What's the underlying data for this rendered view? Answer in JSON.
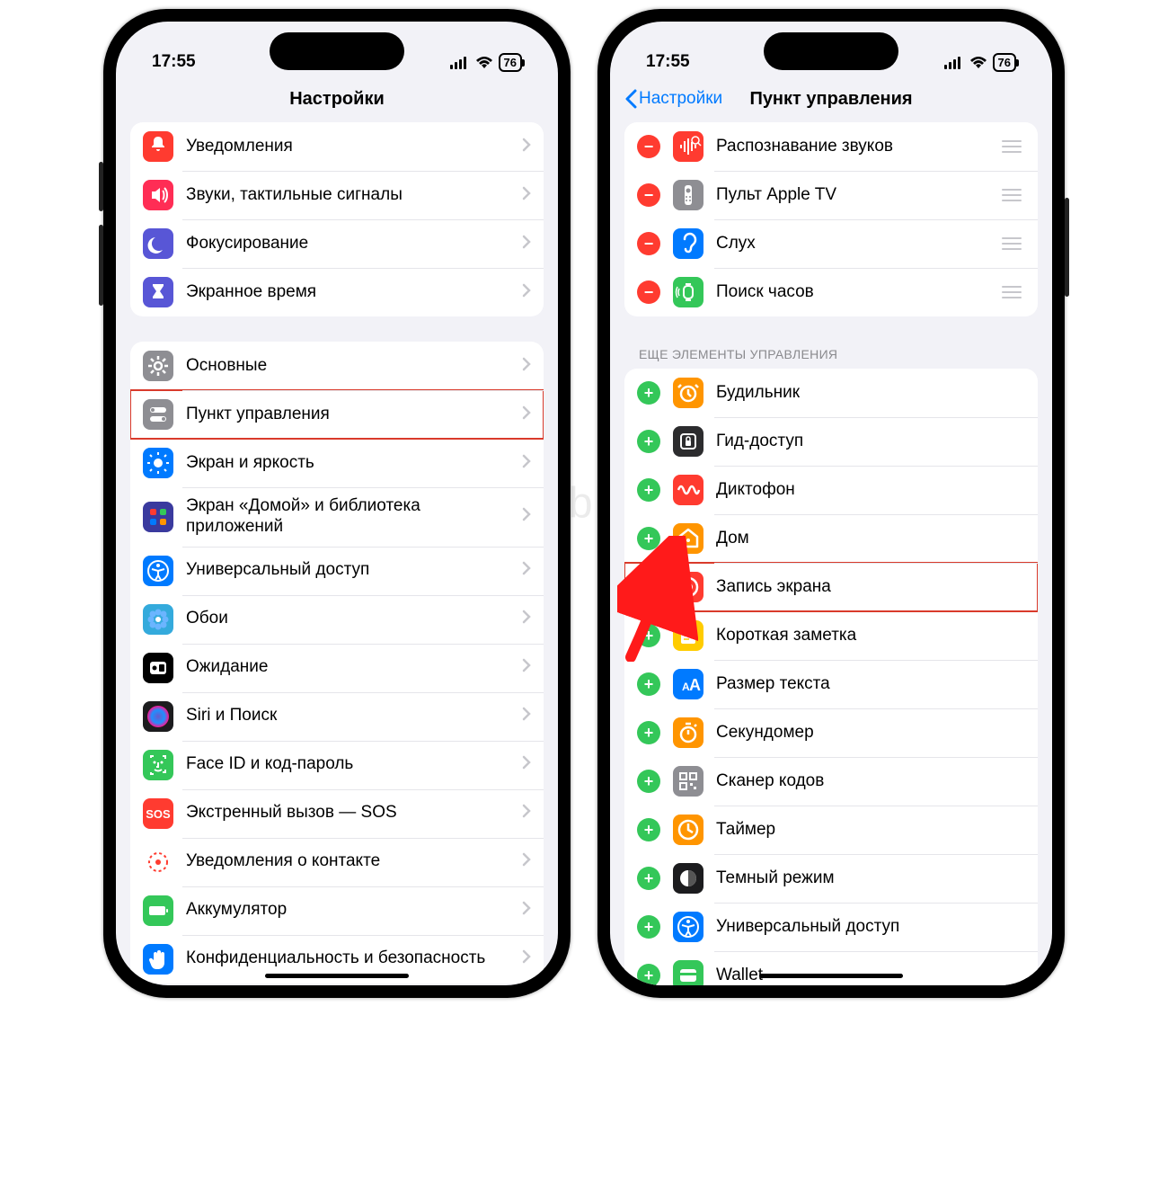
{
  "watermark": "Yablyk",
  "status": {
    "time": "17:55",
    "battery": "76"
  },
  "left_phone": {
    "title": "Настройки",
    "group1": [
      {
        "label": "Уведомления",
        "color": "#ff3b30",
        "icon": "bell"
      },
      {
        "label": "Звуки, тактильные сигналы",
        "color": "#ff2d55",
        "icon": "speaker"
      },
      {
        "label": "Фокусирование",
        "color": "#5856d6",
        "icon": "moon"
      },
      {
        "label": "Экранное время",
        "color": "#5856d6",
        "icon": "hourglass"
      }
    ],
    "group2": [
      {
        "label": "Основные",
        "color": "#8e8e93",
        "icon": "gear"
      },
      {
        "label": "Пункт управления",
        "color": "#8e8e93",
        "icon": "toggles",
        "hl": true
      },
      {
        "label": "Экран и яркость",
        "color": "#007aff",
        "icon": "sun"
      },
      {
        "label": "Экран «Домой» и библиотека приложений",
        "color": "#3a3a9e",
        "icon": "grid"
      },
      {
        "label": "Универсальный доступ",
        "color": "#007aff",
        "icon": "access"
      },
      {
        "label": "Обои",
        "color": "#34aadc",
        "icon": "flower"
      },
      {
        "label": "Ожидание",
        "color": "#000000",
        "icon": "standby"
      },
      {
        "label": "Siri и Поиск",
        "color": "#1c1c1e",
        "icon": "siri"
      },
      {
        "label": "Face ID и код-пароль",
        "color": "#34c759",
        "icon": "faceid"
      },
      {
        "label": "Экстренный вызов — SOS",
        "color": "#ff3b30",
        "icon": "sos"
      },
      {
        "label": "Уведомления о контакте",
        "color": "#ffffff",
        "icon": "expo"
      },
      {
        "label": "Аккумулятор",
        "color": "#34c759",
        "icon": "battery"
      },
      {
        "label": "Конфиденциальность и безопасность",
        "color": "#007aff",
        "icon": "hand"
      }
    ]
  },
  "right_phone": {
    "back": "Настройки",
    "title": "Пункт управления",
    "included": [
      {
        "label": "Распознавание звуков",
        "color": "#ff3b30",
        "icon": "soundrec"
      },
      {
        "label": "Пульт Apple TV",
        "color": "#8e8e93",
        "icon": "remote"
      },
      {
        "label": "Слух",
        "color": "#007aff",
        "icon": "ear"
      },
      {
        "label": "Поиск часов",
        "color": "#34c759",
        "icon": "watchping"
      }
    ],
    "more_header": "ЕЩЕ ЭЛЕМЕНТЫ УПРАВЛЕНИЯ",
    "more": [
      {
        "label": "Будильник",
        "color": "#ff9500",
        "icon": "alarm"
      },
      {
        "label": "Гид-доступ",
        "color": "#2c2c2e",
        "icon": "lock"
      },
      {
        "label": "Диктофон",
        "color": "#ff3b30",
        "icon": "wave"
      },
      {
        "label": "Дом",
        "color": "#ff9500",
        "icon": "home"
      },
      {
        "label": "Запись экрана",
        "color": "#ff3b30",
        "icon": "record",
        "hl": true
      },
      {
        "label": "Короткая заметка",
        "color": "#ffcc00",
        "icon": "note"
      },
      {
        "label": "Размер текста",
        "color": "#007aff",
        "icon": "textsize"
      },
      {
        "label": "Секундомер",
        "color": "#ff9500",
        "icon": "stopwatch"
      },
      {
        "label": "Сканер кодов",
        "color": "#8e8e93",
        "icon": "qr"
      },
      {
        "label": "Таймер",
        "color": "#ff9500",
        "icon": "timer"
      },
      {
        "label": "Темный режим",
        "color": "#1c1c1e",
        "icon": "darkmode"
      },
      {
        "label": "Универсальный доступ",
        "color": "#007aff",
        "icon": "access"
      },
      {
        "label": "Wallet",
        "color": "#34c759",
        "icon": "wallet"
      }
    ]
  }
}
